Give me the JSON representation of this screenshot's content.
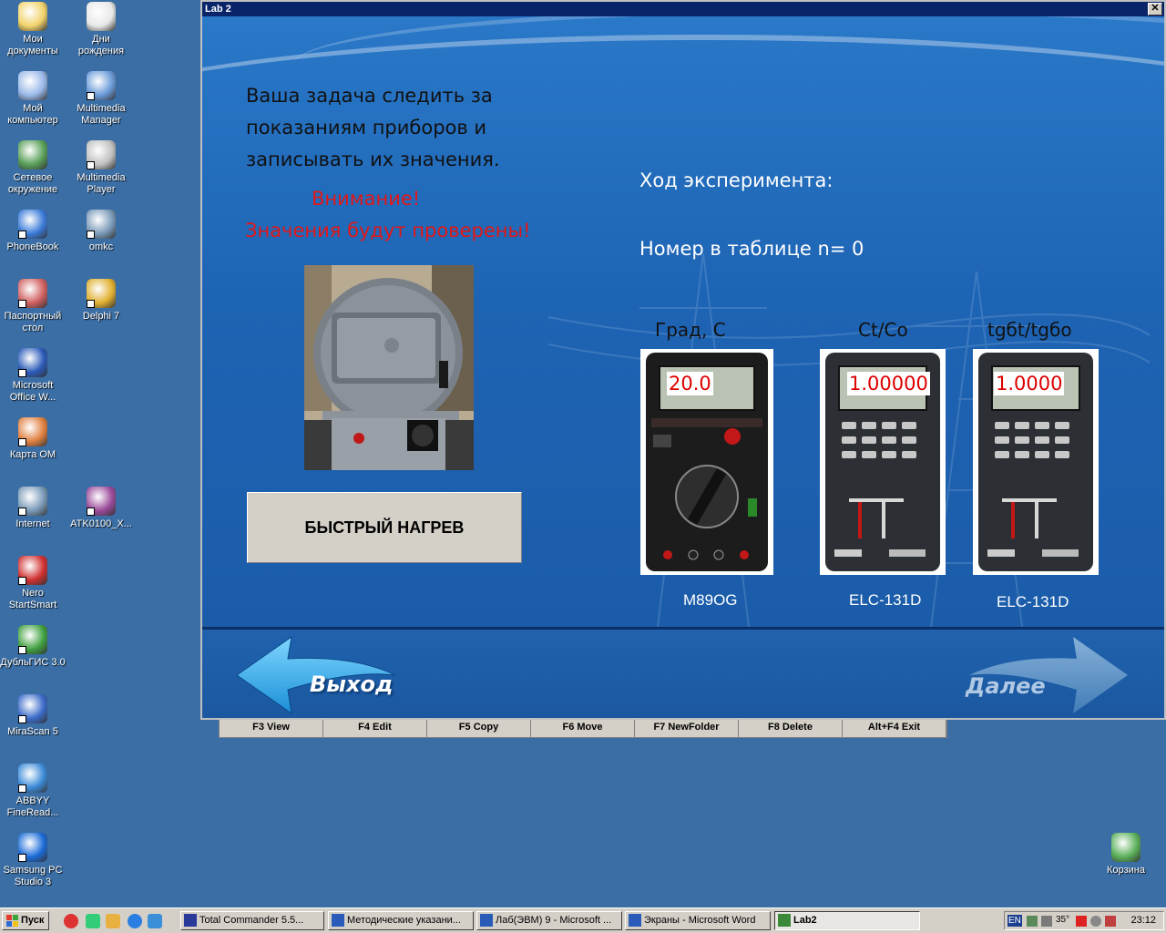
{
  "desktop": {
    "icons": [
      {
        "label": "Мои\nдокументы",
        "icon": "folder-documents-icon"
      },
      {
        "label": "Дни\nрождения",
        "icon": "document-search-icon"
      },
      {
        "label": "Мой\nкомпьютер",
        "icon": "computer-icon"
      },
      {
        "label": "Multimedia\nManager",
        "icon": "multimedia-manager-icon"
      },
      {
        "label": "Сетевое\nокружение",
        "icon": "network-icon"
      },
      {
        "label": "Multimedia\nPlayer",
        "icon": "multimedia-player-icon"
      },
      {
        "label": "PhoneBook",
        "icon": "phone-icon"
      },
      {
        "label": "omkc",
        "icon": "network-computer-icon"
      },
      {
        "label": "Паспортный\nстол",
        "icon": "document-icon"
      },
      {
        "label": "Delphi 7",
        "icon": "delphi-icon"
      },
      {
        "label": "Microsoft\nOffice W...",
        "icon": "word-icon"
      },
      {
        "label": "Карта ОМ",
        "icon": "map-icon"
      },
      {
        "label": "Internet",
        "icon": "internet-icon"
      },
      {
        "label": "ATK0100_X...",
        "icon": "archive-icon"
      },
      {
        "label": "Nero\nStartSmart",
        "icon": "nero-icon"
      },
      {
        "label": "ДубльГИС 3.0",
        "icon": "dublgis-icon"
      },
      {
        "label": "MiraScan 5",
        "icon": "scanner-icon"
      },
      {
        "label": "ABBYY\nFineRead...",
        "icon": "abbyy-icon"
      },
      {
        "label": "Samsung PC\nStudio 3",
        "icon": "samsung-icon"
      },
      {
        "label": "Корзина",
        "icon": "recycle-bin-icon"
      }
    ]
  },
  "total_commander_bar": {
    "keys": [
      "F3 View",
      "F4 Edit",
      "F5 Copy",
      "F6 Move",
      "F7 NewFolder",
      "F8 Delete",
      "Alt+F4 Exit"
    ]
  },
  "window": {
    "title": "Lab 2",
    "close_symbol": "✕"
  },
  "instructions": {
    "line1": "Ваша задача следить за",
    "line2": "показаниям приборов и",
    "line3": "записывать их значения.",
    "warning1": "Внимание!",
    "warning2": "Значения будут проверены!"
  },
  "heat_button": {
    "label": "БЫСТРЫЙ НАГРЕВ"
  },
  "experiment": {
    "heading": "Ход эксперимента:",
    "table_number": "Номер в таблице n= 0"
  },
  "meters": [
    {
      "caption": "Град, С",
      "reading": "20.0",
      "model": "M89OG"
    },
    {
      "caption": "Ct/Co",
      "reading": "1.00000",
      "model": "ELC-131D"
    },
    {
      "caption": "tgбt/tgбo",
      "reading": "1.0000",
      "model": "ELC-131D"
    }
  ],
  "nav": {
    "exit_label": "Выход",
    "next_label": "Далее"
  },
  "taskbar": {
    "start_label": "Пуск",
    "tasks": [
      "Total Commander 5.5...",
      "Методические указани...",
      "Лаб(ЭВМ) 9 - Microsoft ...",
      "Экраны - Microsoft Word",
      "Lab2"
    ],
    "tray_lang": "EN",
    "tray_temp": "35°",
    "clock": "23:12"
  },
  "colors": {
    "desktop": "#3a6ea5",
    "window_bg": "#1f63b0",
    "warning": "#e01818",
    "readout": "#dd0000"
  }
}
